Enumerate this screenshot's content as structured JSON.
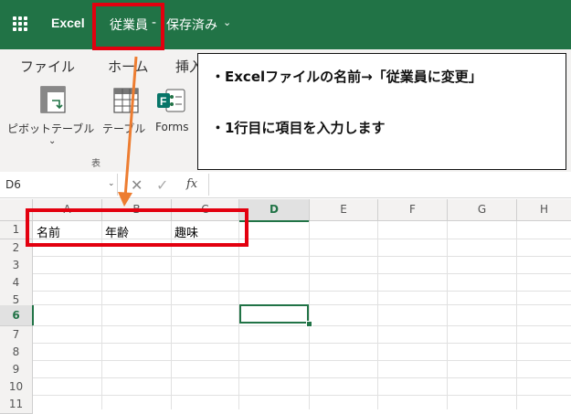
{
  "titlebar": {
    "app_name": "Excel",
    "filename": "従業員",
    "separator": "-",
    "save_status": "保存済み"
  },
  "ribbon": {
    "tabs": [
      "ファイル",
      "ホーム",
      "挿入"
    ],
    "tools": {
      "pivot_label": "ピボットテーブル",
      "table_label": "テーブル",
      "forms_label": "Forms"
    },
    "group_label": "表"
  },
  "formula_bar": {
    "name_box": "D6",
    "fx": "fx"
  },
  "sheet": {
    "columns": [
      "A",
      "B",
      "C",
      "D",
      "E",
      "F",
      "G",
      "H"
    ],
    "rows": [
      "1",
      "2",
      "3",
      "4",
      "5",
      "6",
      "7",
      "8",
      "9",
      "10",
      "11"
    ],
    "active_column": "D",
    "active_row": "6",
    "cells": {
      "A1": "名前",
      "B1": "年齢",
      "C1": "趣味"
    }
  },
  "callout": {
    "line1": "・Excelファイルの名前→「従業員に変更」",
    "line2": "・1行目に項目を入力します"
  },
  "colors": {
    "excel_green": "#217346",
    "highlight_red": "#e3000f",
    "arrow_orange": "#ed7d31"
  }
}
